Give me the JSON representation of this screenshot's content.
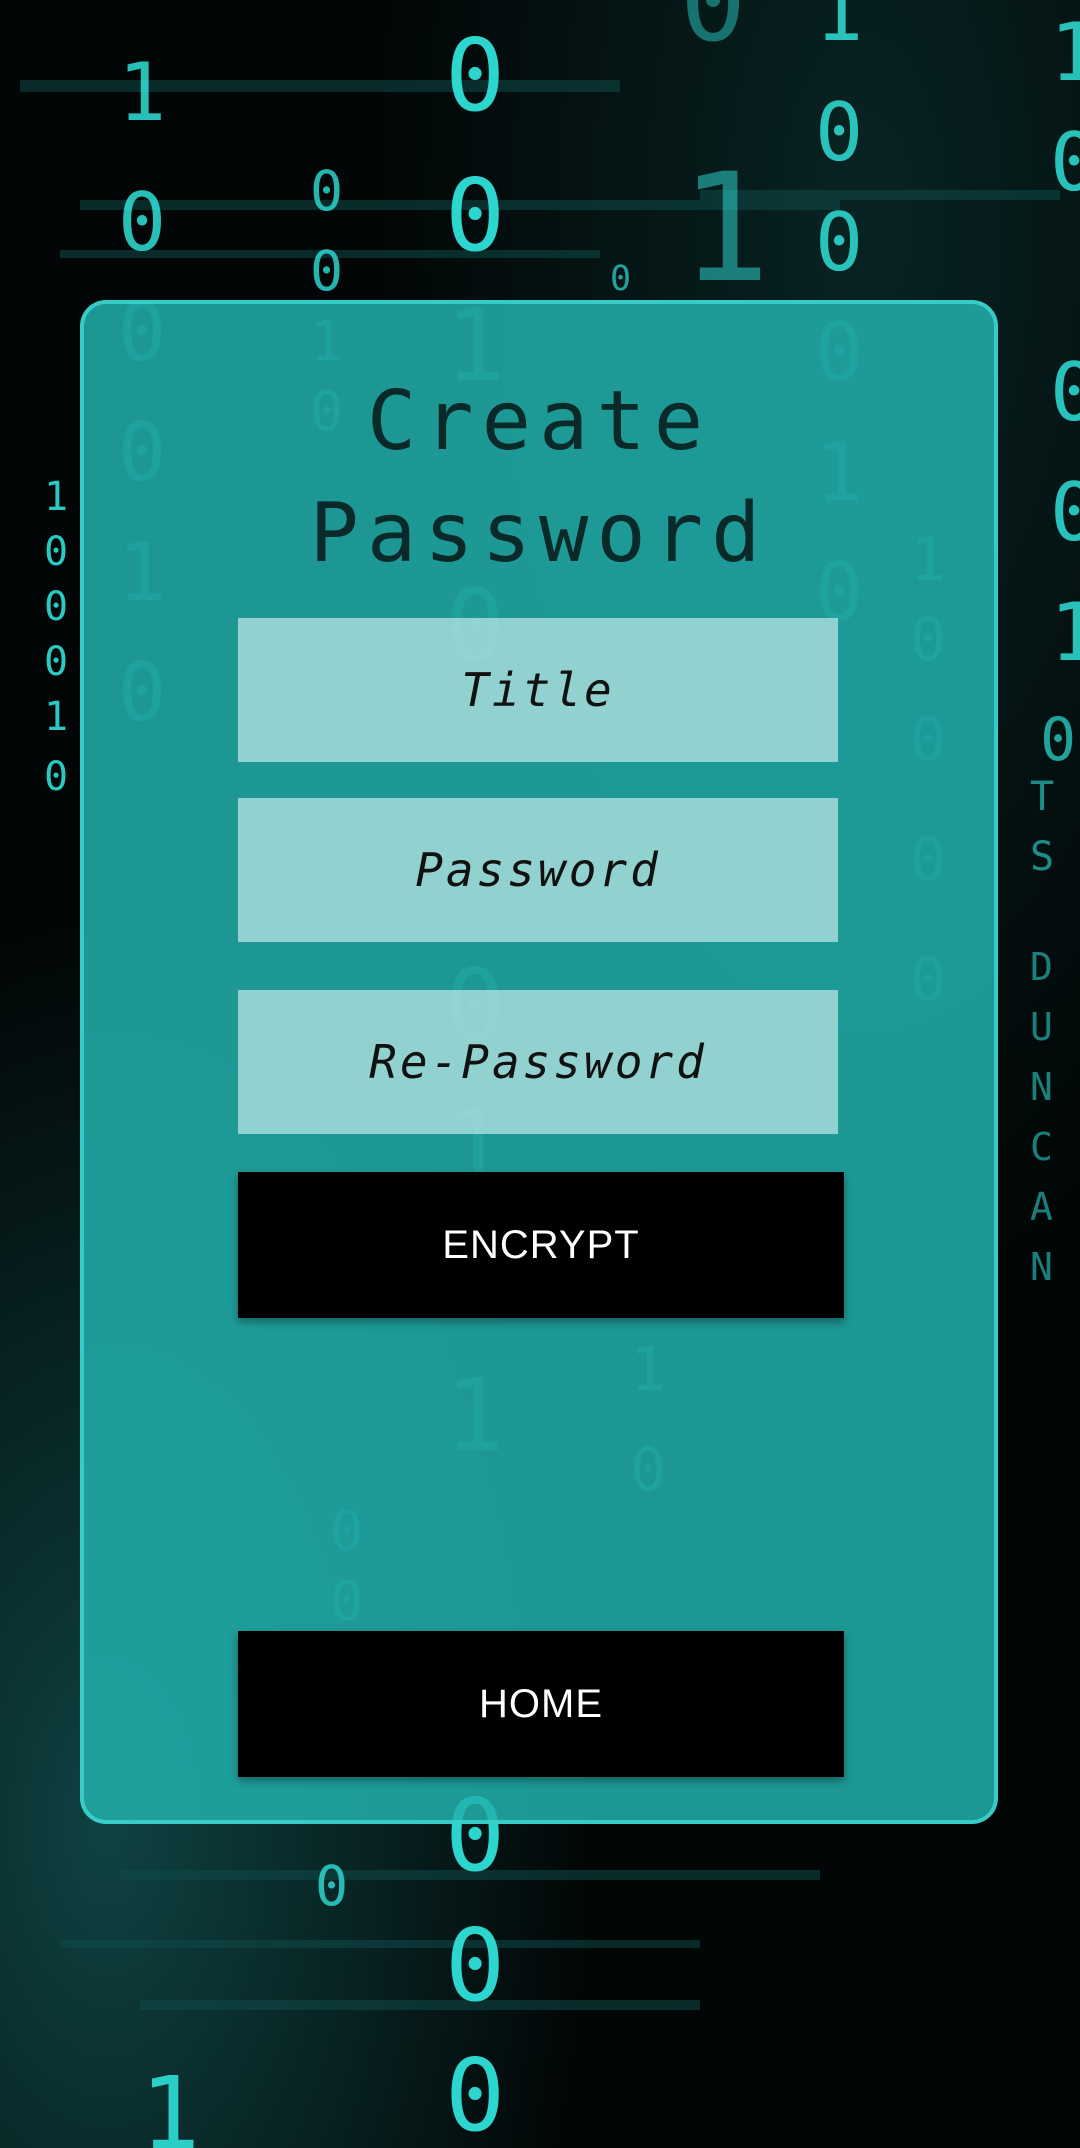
{
  "create_password_screen": {
    "heading": "Create\nPassword",
    "title_field": {
      "placeholder": "Title",
      "value": ""
    },
    "password_field": {
      "placeholder": "Password",
      "value": ""
    },
    "repassword_field": {
      "placeholder": "Re-Password",
      "value": ""
    },
    "encrypt_button_label": "ENCRYPT",
    "home_button_label": "HOME"
  },
  "colors": {
    "card_background": "#22b0ac",
    "matrix_digit": "#2fe0d8",
    "button_background": "#000000",
    "button_text": "#ffffff"
  }
}
